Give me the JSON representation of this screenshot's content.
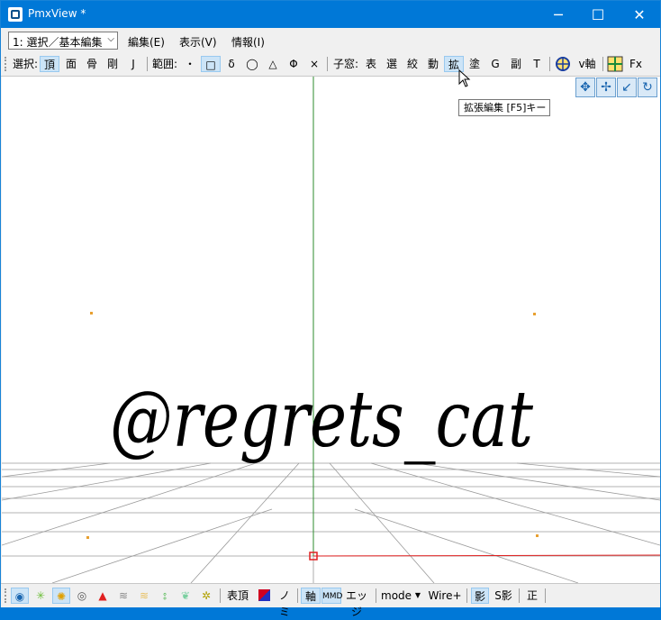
{
  "window": {
    "title": "PmxView *",
    "minimize": "─",
    "maximize": "☐",
    "close": "✕"
  },
  "menubar": {
    "mode_combo": "1: 選択／基本編集",
    "items": [
      "編集(E)",
      "表示(V)",
      "情報(I)"
    ]
  },
  "toolbar": {
    "select_label": "選択:",
    "select_items": [
      "頂",
      "面",
      "骨",
      "剛",
      "J"
    ],
    "range_label": "範囲:",
    "range_items": [
      "・",
      "□",
      "δ",
      "◯",
      "△",
      "Φ",
      "×"
    ],
    "child_label": "子窓:",
    "child_items": [
      "表",
      "選",
      "絞",
      "動",
      "拡",
      "塗",
      "G",
      "副",
      "T"
    ],
    "v_axis": "v軸",
    "fx": "Fx"
  },
  "tooltip": "拡張編集 [F5]キー",
  "watermark": "@regrets_cat",
  "statusbar": {
    "show_vertex": "表頂",
    "no_label": "ノミ",
    "axis": "軸",
    "edge": "エッジ",
    "mode": "mode",
    "wire": "Wire+",
    "shadow": "影",
    "s_shadow": "S影",
    "front": "正"
  },
  "colors": {
    "titlebar": "#0078d7",
    "y_axis": "#2e8b2e",
    "x_axis": "#e02020",
    "point": "#e8a030"
  }
}
